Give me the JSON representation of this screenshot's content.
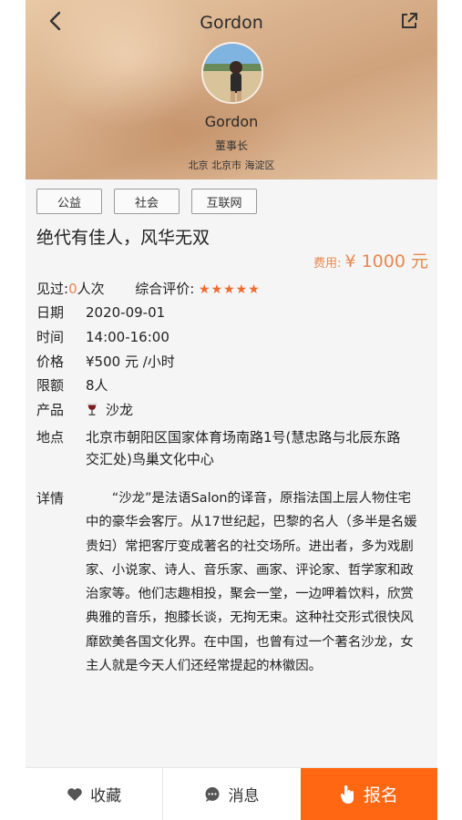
{
  "header": {
    "title": "Gordon",
    "user_name": "Gordon",
    "user_title": "董事长",
    "location": "北京 北京市 海淀区"
  },
  "tags": [
    "公益",
    "社会",
    "互联网"
  ],
  "event": {
    "title": "绝代有佳人，风华无双",
    "fee_label": "费用:",
    "fee_amount": "¥ 1000 元"
  },
  "info": {
    "seen_label": "见过:",
    "seen_count": "0",
    "seen_unit": "人次",
    "rating_label": "综合评价:",
    "rating_stars": "★★★★★",
    "rating_value": 5,
    "date_label": "日期",
    "date": "2020-09-01",
    "time_label": "时间",
    "time": "14:00-16:00",
    "price_label": "价格",
    "price": "¥500 元 /小时",
    "quota_label": "限额",
    "quota": "8人",
    "product_label": "产品",
    "product": "沙龙",
    "address_label": "地点",
    "address": "北京市朝阳区国家体育场南路1号(慧忠路与北辰东路交汇处)鸟巢文化中心",
    "detail_label": "详情",
    "detail": "“沙龙”是法语Salon的译音，原指法国上层人物住宅中的豪华会客厅。从17世纪起，巴黎的名人（多半是名媛贵妇）常把客厅变成著名的社交场所。进出者，多为戏剧家、小说家、诗人、音乐家、画家、评论家、哲学家和政治家等。他们志趣相投，聚会一堂，一边呷着饮料，欣赏典雅的音乐，抱膝长谈，无拘无束。这种社交形式很快风靡欧美各国文化界。在中国，也曾有过一个著名沙龙，女主人就是今天人们还经常提起的林徽因。"
  },
  "bottom_bar": {
    "favorite_label": "收藏",
    "message_label": "消息",
    "signup_label": "报名"
  },
  "colors": {
    "accent": "#ff6712",
    "fee": "#e8884e",
    "stars": "#ef6a2d"
  },
  "icons": [
    "back-arrow-icon",
    "share-icon",
    "wine-glass-icon",
    "heart-icon",
    "chat-bubble-icon",
    "tap-hand-icon"
  ]
}
